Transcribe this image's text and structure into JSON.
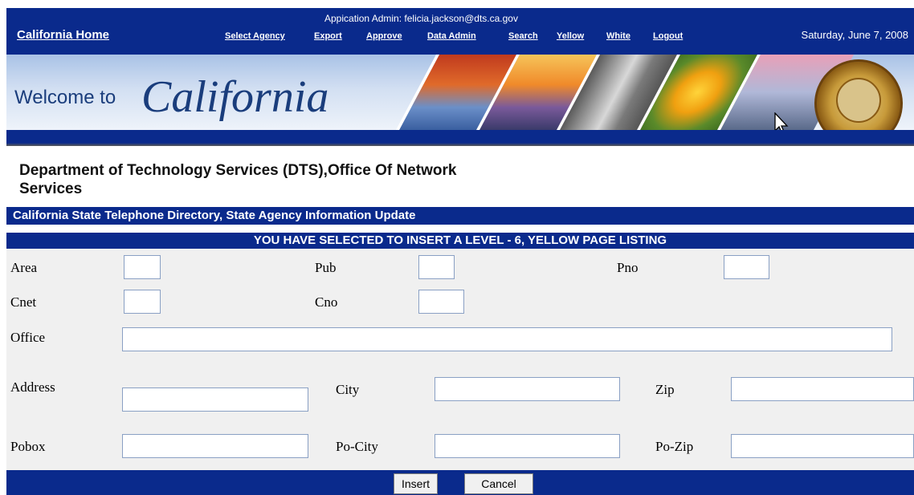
{
  "header": {
    "home_link": "California Home",
    "admin_line": "Appication Admin: felicia.jackson@dts.ca.gov",
    "date": "Saturday, June 7, 2008",
    "nav": [
      "Select Agency",
      "Export",
      "Approve",
      "Data Admin",
      "Search",
      "Yellow",
      "White",
      "Logout"
    ]
  },
  "banner": {
    "welcome": "Welcome to",
    "title": "California"
  },
  "department": "Department of Technology Services (DTS),Office Of Network Services",
  "directory_bar": "California State Telephone Directory, State Agency Information Update",
  "selection_bar": "YOU HAVE SELECTED TO INSERT A LEVEL - 6, YELLOW PAGE LISTING",
  "form": {
    "labels": {
      "area": "Area",
      "pub": "Pub",
      "pno": "Pno",
      "cnet": "Cnet",
      "cno": "Cno",
      "office": "Office",
      "address": "Address",
      "city": "City",
      "zip": "Zip",
      "pobox": "Pobox",
      "po_city": "Po-City",
      "po_zip": "Po-Zip"
    },
    "values": {
      "area": "",
      "pub": "",
      "pno": "",
      "cnet": "",
      "cno": "",
      "office": "",
      "address": "",
      "city": "",
      "zip": "",
      "pobox": "",
      "po_city": "",
      "po_zip": ""
    }
  },
  "buttons": {
    "insert": "Insert",
    "cancel": "Cancel"
  },
  "colors": {
    "nav_blue": "#0a2a8c",
    "form_bg": "#f0f0f0"
  },
  "icons": {
    "cursor": "mouse-pointer-icon",
    "seal": "state-seal-icon"
  }
}
